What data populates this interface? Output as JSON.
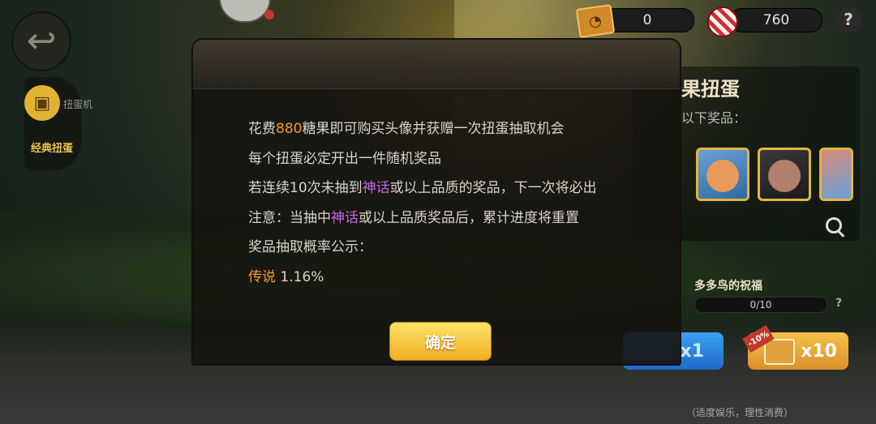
{
  "topbar": {
    "ticket_count": "0",
    "candy_count": "760",
    "help_label": "?"
  },
  "sidebar": {
    "category_label": "扭蛋机",
    "active_label": "经典扭蛋"
  },
  "right_panel": {
    "title": "果扭蛋",
    "subtitle": "以下奖品：",
    "blessing_label": "多多鸟的祝福",
    "progress_text": "0/10",
    "progress_value": 0,
    "small_help": "?",
    "x1_label": "x1",
    "x10_label": "x10",
    "discount_label": "-10%",
    "footer_note": "（适度娱乐，理性消费）"
  },
  "modal": {
    "line1_pre": "花费",
    "line1_num": "880",
    "line1_post": "糖果即可购买头像并获赠一次扭蛋抽取机会",
    "line2": "每个扭蛋必定开出一件随机奖品",
    "line3_pre": "若连续10次未抽到",
    "line3_hl": "神话",
    "line3_post": "或以上品质的奖品，下一次将必出",
    "line4_pre": "注意：当抽中",
    "line4_hl": "神话",
    "line4_post": "或以上品质奖品后，累计进度将重置",
    "line5": "奖品抽取概率公示：",
    "rate_label": "传说",
    "rate_value": "1.16%",
    "confirm_label": "确定"
  },
  "colors": {
    "accent_orange": "#f59a2a",
    "accent_purple": "#c06ae8",
    "button_gold": "#f2ae22",
    "button_blue": "#1f6ac8"
  }
}
